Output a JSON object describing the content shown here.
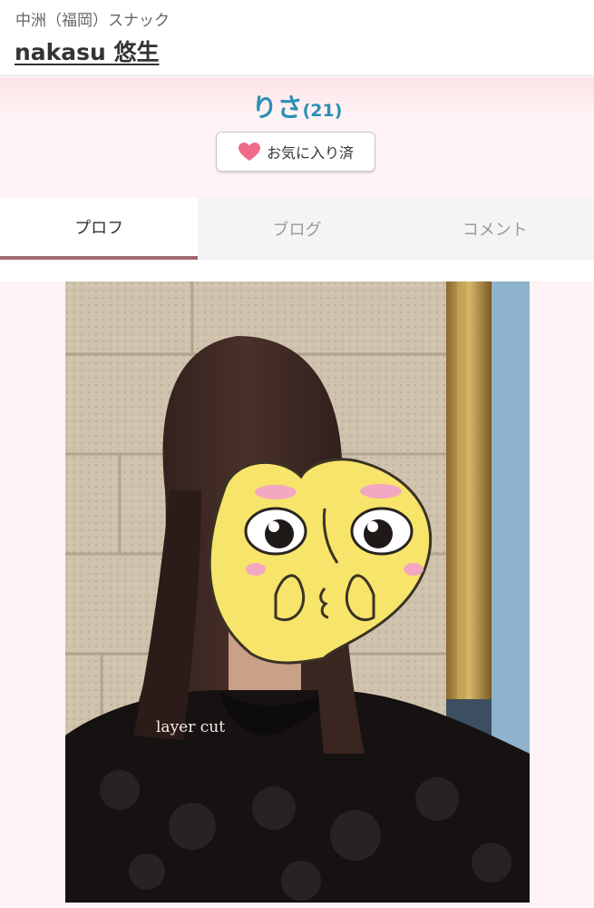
{
  "header": {
    "area_label": "中洲（福岡）スナック",
    "shop_name": "nakasu 悠生"
  },
  "profile": {
    "name": "りさ",
    "age": "(21)",
    "favorite_button": {
      "label": "お気に入り済",
      "icon": "heart-icon",
      "icon_color": "#f06a8a"
    }
  },
  "tabs": [
    {
      "label": "プロフ",
      "active": true
    },
    {
      "label": "ブログ",
      "active": false
    },
    {
      "label": "コメント",
      "active": false
    }
  ],
  "photo": {
    "caption": "layer cut"
  },
  "colors": {
    "accent_name": "#2a8fb6",
    "tab_underline": "#9e6b6e",
    "band_background": "#fff2f4"
  }
}
